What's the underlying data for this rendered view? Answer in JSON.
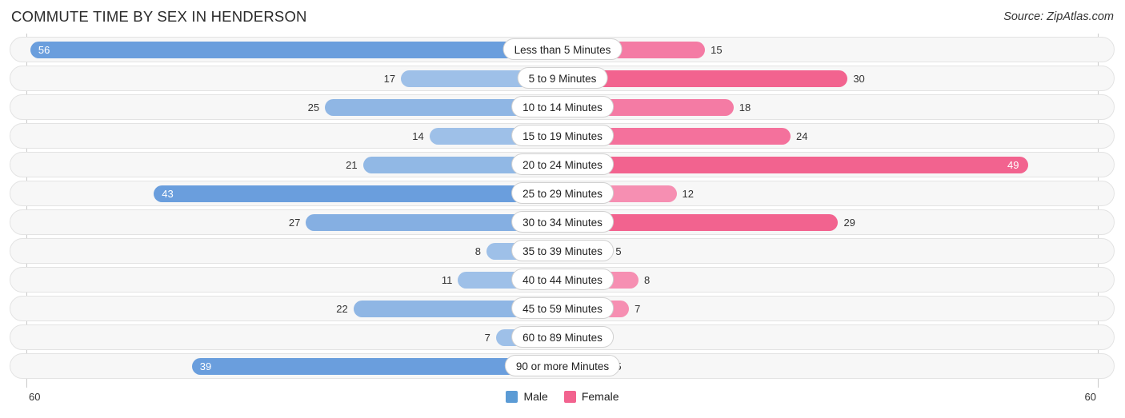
{
  "header": {
    "title": "COMMUTE TIME BY SEX IN HENDERSON",
    "source": "Source: ZipAtlas.com"
  },
  "axis": {
    "left_label": "60",
    "right_label": "60",
    "max": 60
  },
  "legend": {
    "items": [
      {
        "label": "Male",
        "color": "#5b9bd5"
      },
      {
        "label": "Female",
        "color": "#f2638f"
      }
    ]
  },
  "colors": {
    "male_dark": "#6a9edd",
    "male_mid": "#8fb6e4",
    "male_light": "#9ec0e8",
    "female_dark": "#f2638f",
    "female_mid": "#f47ba4",
    "female_light": "#f9a8c2",
    "track_bg": "#f7f7f7",
    "track_border": "#e3e3e3"
  },
  "chart_data": {
    "type": "bar",
    "title": "COMMUTE TIME BY SEX IN HENDERSON",
    "subtitle": "Source: ZipAtlas.com",
    "orientation": "horizontal-diverging",
    "xlabel": "",
    "ylabel": "",
    "xlim": [
      -60,
      60
    ],
    "grid": false,
    "legend_position": "bottom-center",
    "categories": [
      "Less than 5 Minutes",
      "5 to 9 Minutes",
      "10 to 14 Minutes",
      "15 to 19 Minutes",
      "20 to 24 Minutes",
      "25 to 29 Minutes",
      "30 to 34 Minutes",
      "35 to 39 Minutes",
      "40 to 44 Minutes",
      "45 to 59 Minutes",
      "60 to 89 Minutes",
      "90 or more Minutes"
    ],
    "series": [
      {
        "name": "Male",
        "color": "#5b9bd5",
        "values": [
          56,
          17,
          25,
          14,
          21,
          43,
          27,
          8,
          11,
          22,
          7,
          39
        ]
      },
      {
        "name": "Female",
        "color": "#f2638f",
        "values": [
          15,
          30,
          18,
          24,
          49,
          12,
          29,
          5,
          8,
          7,
          0,
          5
        ]
      }
    ]
  },
  "rows": [
    {
      "label": "Less than 5 Minutes",
      "male": 56,
      "female": 15,
      "male_color": "#6a9edd",
      "female_color": "#f47ba4",
      "male_inside": true,
      "female_inside": false
    },
    {
      "label": "5 to 9 Minutes",
      "male": 17,
      "female": 30,
      "male_color": "#9ec0e8",
      "female_color": "#f2638f",
      "male_inside": false,
      "female_inside": false
    },
    {
      "label": "10 to 14 Minutes",
      "male": 25,
      "female": 18,
      "male_color": "#8fb6e4",
      "female_color": "#f47ba4",
      "male_inside": false,
      "female_inside": false
    },
    {
      "label": "15 to 19 Minutes",
      "male": 14,
      "female": 24,
      "male_color": "#9ec0e8",
      "female_color": "#f4719c",
      "male_inside": false,
      "female_inside": false
    },
    {
      "label": "20 to 24 Minutes",
      "male": 21,
      "female": 49,
      "male_color": "#91b8e5",
      "female_color": "#f2638f",
      "male_inside": false,
      "female_inside": true
    },
    {
      "label": "25 to 29 Minutes",
      "male": 43,
      "female": 12,
      "male_color": "#6a9edd",
      "female_color": "#f68fb2",
      "male_inside": true,
      "female_inside": false
    },
    {
      "label": "30 to 34 Minutes",
      "male": 27,
      "female": 29,
      "male_color": "#85afe2",
      "female_color": "#f2638f",
      "male_inside": false,
      "female_inside": false
    },
    {
      "label": "35 to 39 Minutes",
      "male": 8,
      "female": 5,
      "male_color": "#9ec0e8",
      "female_color": "#f9a8c2",
      "male_inside": false,
      "female_inside": false
    },
    {
      "label": "40 to 44 Minutes",
      "male": 11,
      "female": 8,
      "male_color": "#9ec0e8",
      "female_color": "#f68fb2",
      "male_inside": false,
      "female_inside": false
    },
    {
      "label": "45 to 59 Minutes",
      "male": 22,
      "female": 7,
      "male_color": "#8fb6e4",
      "female_color": "#f68fb2",
      "male_inside": false,
      "female_inside": false
    },
    {
      "label": "60 to 89 Minutes",
      "male": 7,
      "female": 0,
      "male_color": "#9ec0e8",
      "female_color": "#f9a8c2",
      "male_inside": false,
      "female_inside": false
    },
    {
      "label": "90 or more Minutes",
      "male": 39,
      "female": 5,
      "male_color": "#6a9edd",
      "female_color": "#f9a8c2",
      "male_inside": true,
      "female_inside": false
    }
  ]
}
